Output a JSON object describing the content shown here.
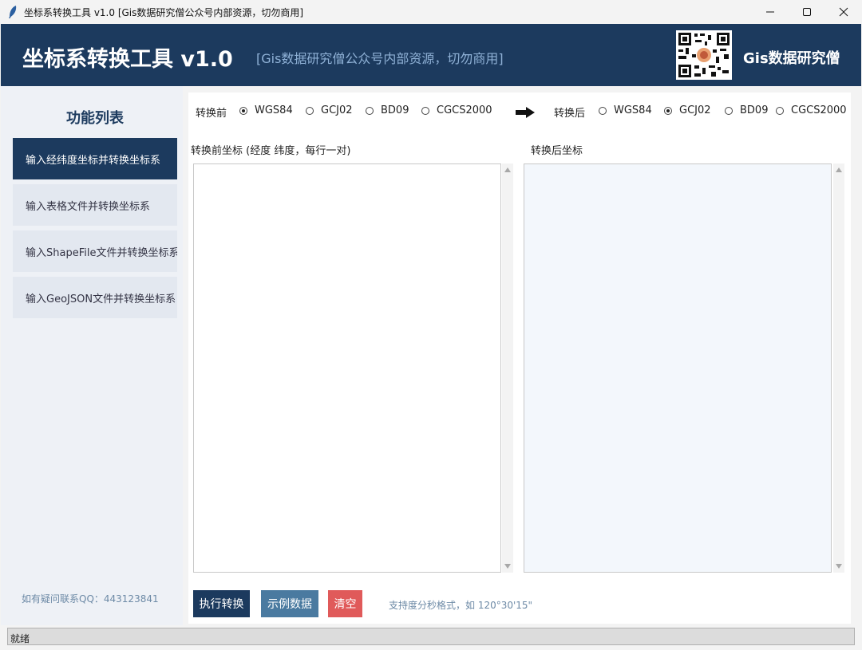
{
  "window": {
    "title": "坐标系转换工具 v1.0 [Gis数据研究僧公众号内部资源，切勿商用]"
  },
  "header": {
    "title": "坐标系转换工具 v1.0",
    "subtitle": "[Gis数据研究僧公众号内部资源，切勿商用]",
    "org_name": "Gis数据研究僧"
  },
  "sidebar": {
    "title": "功能列表",
    "items": [
      {
        "label": "输入经纬度坐标并转换坐标系",
        "active": true
      },
      {
        "label": "输入表格文件并转换坐标系",
        "active": false
      },
      {
        "label": "输入ShapeFile文件并转换坐标系",
        "active": false
      },
      {
        "label": "输入GeoJSON文件并转换坐标系",
        "active": false
      }
    ],
    "contact": "如有疑问联系QQ：443123841"
  },
  "conversion": {
    "from_label": "转换前",
    "to_label": "转换后",
    "from_options": [
      "WGS84",
      "GCJ02",
      "BD09",
      "CGCS2000"
    ],
    "from_selected": "WGS84",
    "to_options": [
      "WGS84",
      "GCJ02",
      "BD09",
      "CGCS2000"
    ],
    "to_selected": "GCJ02"
  },
  "input_panel": {
    "label": "转换前坐标 (经度 纬度，每行一对)",
    "value": ""
  },
  "output_panel": {
    "label": "转换后坐标",
    "value": ""
  },
  "buttons": {
    "convert": "执行转换",
    "sample": "示例数据",
    "clear": "清空"
  },
  "hint": "支持度分秒格式，如 120°30'15\"",
  "status": "就绪",
  "colors": {
    "primary": "#1c3a5e",
    "secondary": "#4a7aa0",
    "danger": "#e05a5a"
  }
}
